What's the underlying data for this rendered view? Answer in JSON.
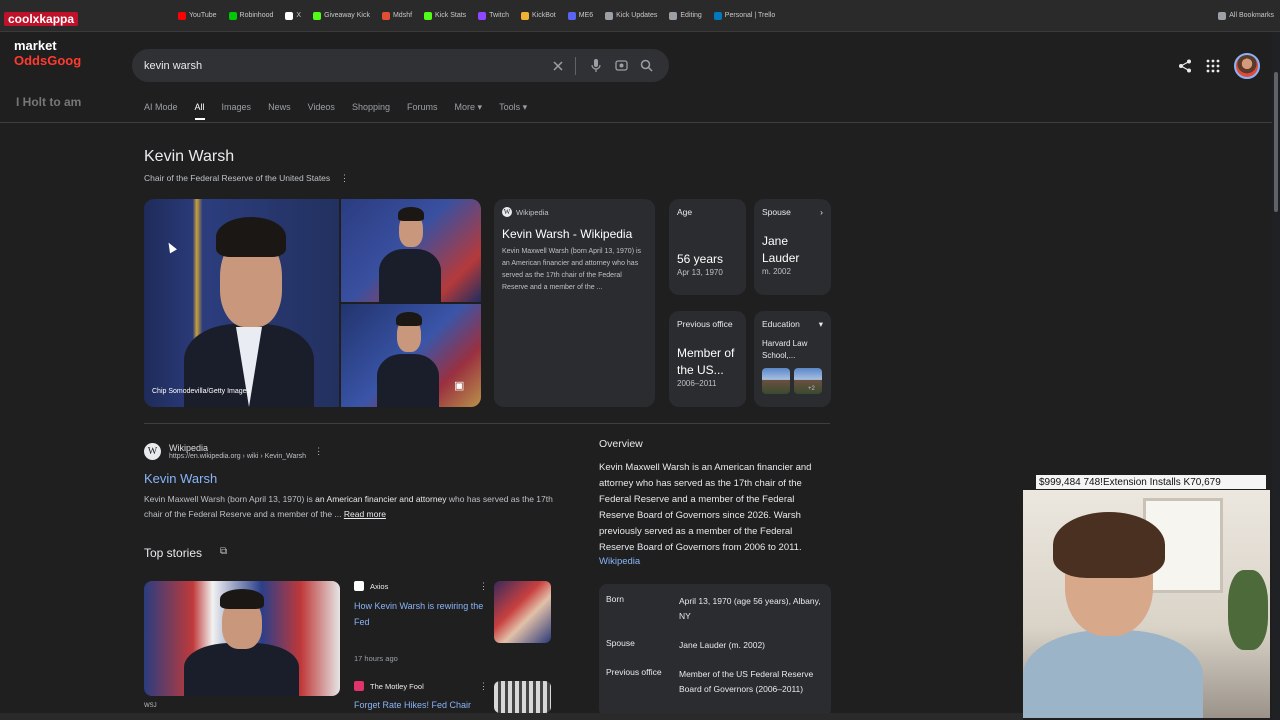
{
  "bookmarks": [
    {
      "label": "YouTube",
      "color": "#ff0000"
    },
    {
      "label": "Robinhood",
      "color": "#00c805"
    },
    {
      "label": "X",
      "color": "#ffffff"
    },
    {
      "label": "Giveaway Kick",
      "color": "#53fc18"
    },
    {
      "label": "Mdshf",
      "color": "#e05030"
    },
    {
      "label": "Kick Stats",
      "color": "#53fc18"
    },
    {
      "label": "Twitch",
      "color": "#9146ff"
    },
    {
      "label": "KickBot",
      "color": "#f2b134"
    },
    {
      "label": "ME6",
      "color": "#5865f2"
    },
    {
      "label": "Kick Updates",
      "color": "#9aa0a6"
    },
    {
      "label": "Editing",
      "color": "#9aa0a6"
    },
    {
      "label": "Personal | Trello",
      "color": "#0079bf"
    }
  ],
  "bookmarks_all": "All Bookmarks",
  "overlay_tag": "coolxkappa",
  "logo": {
    "line1": "market",
    "line2": "OddsGoog"
  },
  "ghost_text": "I Holt  to am",
  "search": {
    "query": "kevin warsh"
  },
  "tabs": [
    "AI Mode",
    "All",
    "Images",
    "News",
    "Videos",
    "Shopping",
    "Forums",
    "More",
    "Tools"
  ],
  "kp": {
    "title": "Kevin Warsh",
    "subtitle": "Chair of the Federal Reserve of the United States",
    "image_credit": "Chip Somodevilla/Getty Images",
    "wiki": {
      "source": "Wikipedia",
      "title": "Kevin Warsh - Wikipedia",
      "text": "Kevin Maxwell Warsh (born April 13, 1970) is an American financier and attorney who has served as the 17th chair of the Federal Reserve and a member of the ..."
    },
    "age": {
      "label": "Age",
      "value": "56 years",
      "sub": "Apr 13, 1970"
    },
    "spouse": {
      "label": "Spouse",
      "value": "Jane Lauder",
      "sub": "m. 2002"
    },
    "office": {
      "label": "Previous office",
      "value": "Member of the US...",
      "sub": "2006–2011"
    },
    "education": {
      "label": "Education",
      "value": "Harvard Law School,...",
      "more": "+2"
    }
  },
  "result": {
    "site": "Wikipedia",
    "url": "https://en.wikipedia.org › wiki › Kevin_Warsh",
    "title": "Kevin Warsh",
    "snippet_a": "Kevin Maxwell Warsh (born April 13, 1970) is ",
    "snippet_b": "an American financier and attorney",
    "snippet_c": " who has served as the 17th chair of the Federal Reserve and a member of the ...",
    "read_more": "Read more"
  },
  "top_stories": {
    "title": "Top stories",
    "stories": [
      {
        "source": "Axios",
        "headline": "How Kevin Warsh is rewiring the Fed",
        "time": "17 hours ago"
      },
      {
        "source": "The Motley Fool",
        "headline": "Forget Rate Hikes! Fed Chair"
      }
    ],
    "bottom_source": "WSJ"
  },
  "overview": {
    "title": "Overview",
    "text": "Kevin Maxwell Warsh is an American financier and attorney who has served as the 17th chair of the Federal Reserve and a member of the Federal Reserve Board of Governors since 2026. Warsh previously served as a member of the Federal Reserve Board of Governors from 2006 to 2011.",
    "link": "Wikipedia",
    "rows": [
      {
        "k": "Born",
        "v": "April 13, 1970 (age 56 years), Albany, NY"
      },
      {
        "k": "Spouse",
        "v": "Jane Lauder (m. 2002)"
      },
      {
        "k": "Previous office",
        "v": "Member of the US Federal Reserve Board of Governors (2006–2011)"
      }
    ]
  },
  "stream_bar": "$999,484 748!Extension Installs K70,679"
}
